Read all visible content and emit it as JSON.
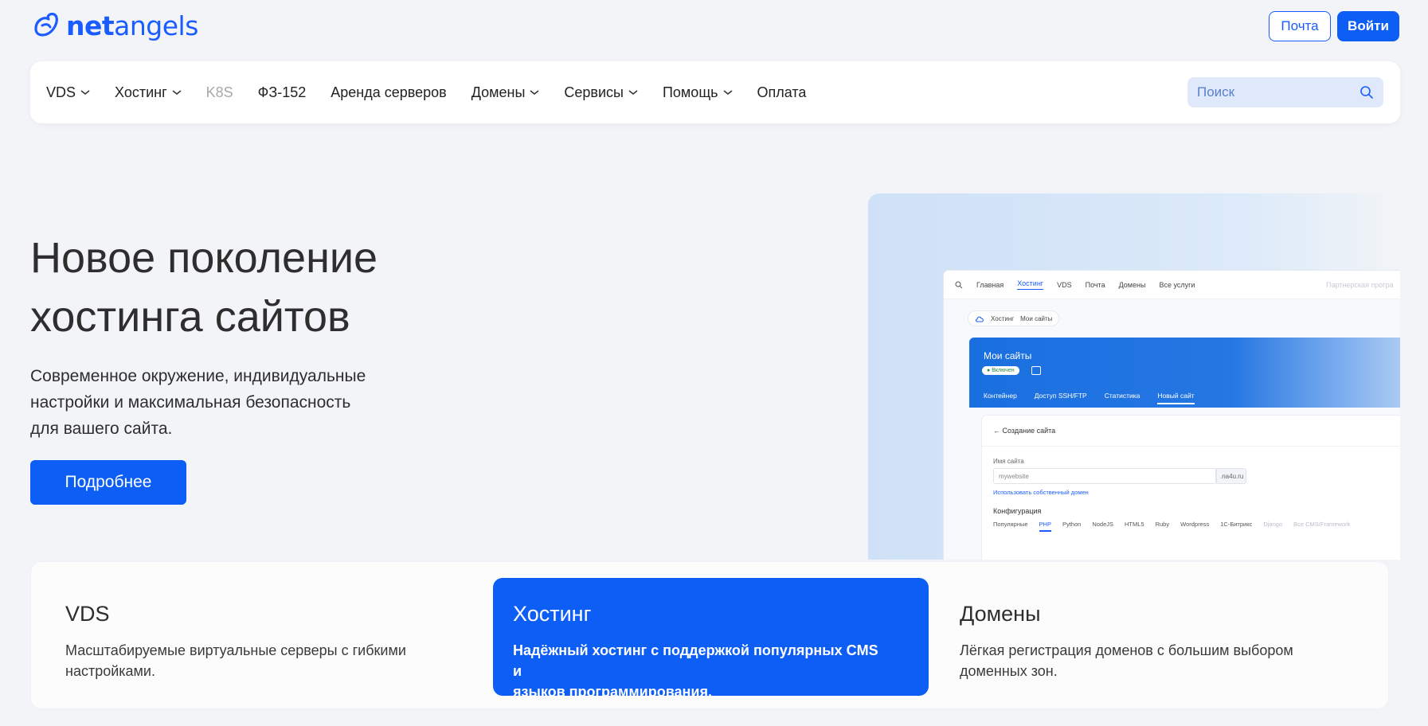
{
  "header": {
    "logo_text_bold": "net",
    "logo_text_rest": "angels",
    "mail_label": "Почта",
    "login_label": "Войти"
  },
  "nav": {
    "items": [
      {
        "label": "VDS",
        "dropdown": true
      },
      {
        "label": "Хостинг",
        "dropdown": true
      },
      {
        "label": "K8S",
        "dropdown": false,
        "muted": true
      },
      {
        "label": "ФЗ-152",
        "dropdown": false
      },
      {
        "label": "Аренда серверов",
        "dropdown": false
      },
      {
        "label": "Домены",
        "dropdown": true
      },
      {
        "label": "Сервисы",
        "dropdown": true
      },
      {
        "label": "Помощь",
        "dropdown": true
      },
      {
        "label": "Оплата",
        "dropdown": false
      }
    ],
    "search_placeholder": "Поиск"
  },
  "hero": {
    "title_line1": "Новое поколение",
    "title_line2": "хостинга сайтов",
    "subtitle_line1": "Современное окружение, индивидуальные",
    "subtitle_line2": "настройки и максимальная безопасность",
    "subtitle_line3": "для вашего сайта.",
    "button_label": "Подробнее"
  },
  "mockup": {
    "nav": [
      "Главная",
      "Хостинг",
      "VDS",
      "Почта",
      "Домены",
      "Все услуги"
    ],
    "nav_right": "Партнерская програ",
    "crumb_1": "Хостинг",
    "crumb_2": "Мои сайты",
    "panel_title": "Мои сайты",
    "status_pill": "Включен",
    "tabs": [
      "Контейнер",
      "Доступ SSH/FTP",
      "Статистика",
      "Новый сайт"
    ],
    "card_title": "Создание сайта",
    "field_label": "Имя сайта",
    "field_value": "mywebsite",
    "field_suffix": ".na4u.ru",
    "own_domain_link": "Использовать собственный домен",
    "config_label": "Конфигурация",
    "languages": [
      "Популярные",
      "PHP",
      "Python",
      "NodeJS",
      "HTML5",
      "Ruby",
      "Wordpress",
      "1С-Битрикс",
      "Django",
      "Все CMS/Framework"
    ]
  },
  "cards": [
    {
      "title": "VDS",
      "line1": "Масштабируемые виртуальные серверы с гибкими",
      "line2": "настройками."
    },
    {
      "title": "Хостинг",
      "line1": "Надёжный хостинг с поддержкой популярных CMS и",
      "line2": "языков программирования."
    },
    {
      "title": "Домены",
      "line1": "Лёгкая регистрация доменов с большим выбором",
      "line2": "доменных зон."
    }
  ],
  "colors": {
    "brand": "#0d5ef5",
    "background": "#f2f4f7",
    "search_bg": "#dfe9fb"
  }
}
